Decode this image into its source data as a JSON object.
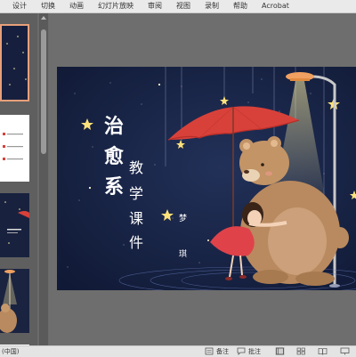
{
  "ribbon": {
    "tabs": [
      "设计",
      "切换",
      "动画",
      "幻灯片放映",
      "审阅",
      "视图",
      "录制",
      "帮助",
      "Acrobat"
    ]
  },
  "thumbnails": {
    "thumb2_lines": [
      "",
      "",
      ""
    ],
    "thumb3_text": "教学课件"
  },
  "slide": {
    "title": "治愈系",
    "title_chars": [
      "治",
      "愈",
      "系"
    ],
    "subtitle": "教学课件",
    "subtitle_chars": [
      "教",
      "学",
      "课",
      "件"
    ],
    "small_a": "梦",
    "small_b": "琪"
  },
  "status": {
    "language": "(中国)",
    "notes_label": "备注",
    "comments_label": "批注"
  },
  "colors": {
    "umbrella": "#d8413a",
    "bear": "#b98a5f",
    "night": "#15203d",
    "lamp": "#f0a060",
    "selected_thumb_border": "#e7a07a"
  },
  "icons": [
    "notes-icon",
    "comments-icon",
    "normal-view-icon",
    "slide-sorter-icon",
    "reading-view-icon",
    "slideshow-icon"
  ]
}
